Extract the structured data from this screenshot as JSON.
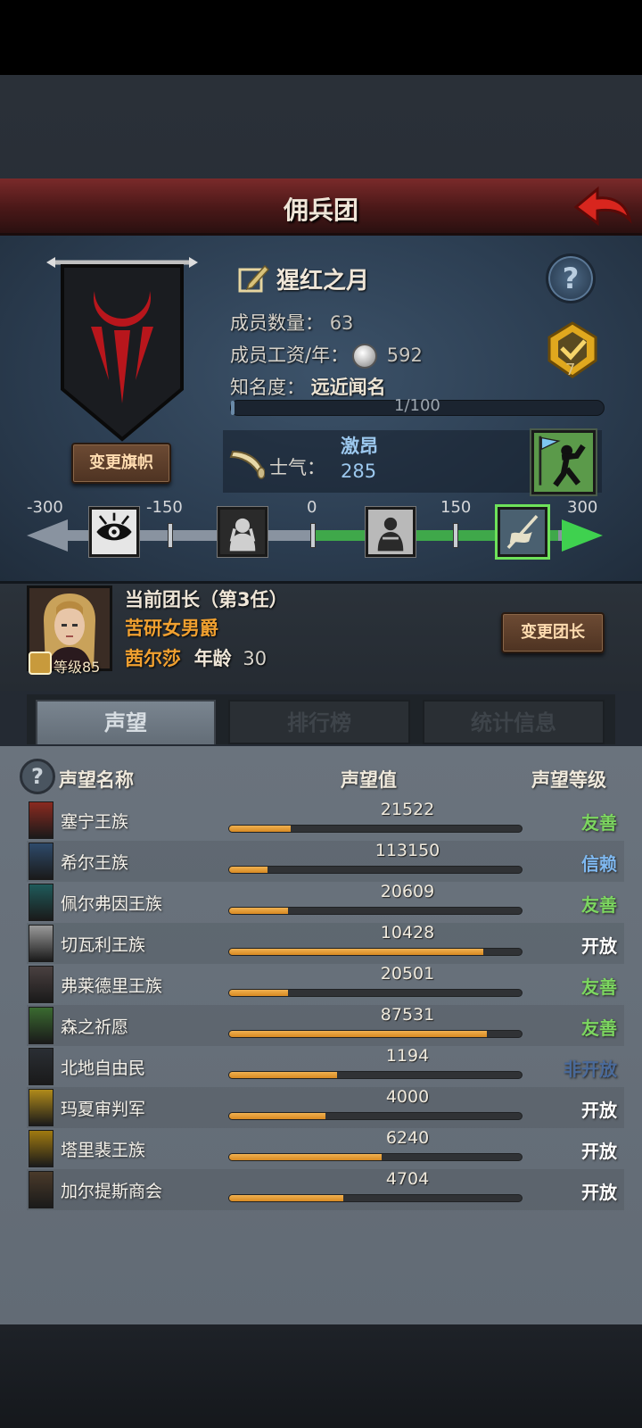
{
  "title": "佣兵团",
  "guild": {
    "name": "猩红之月",
    "member_count_label": "成员数量：",
    "member_count": "63",
    "salary_label": "成员工资/年：",
    "salary": "592",
    "fame_label": "知名度：",
    "fame": "远近闻名",
    "fame_progress": "1/100",
    "fame_fraction": 0.01,
    "change_banner_label": "变更旗帜",
    "rank_number": "7"
  },
  "morale": {
    "label": "士气：",
    "word": "激昂",
    "value": "285",
    "value_num": 285,
    "scale_labels": [
      "-300",
      "-150",
      "0",
      "150",
      "300"
    ],
    "scale_icons": [
      "eye-icon",
      "despair-icon",
      "calm-icon",
      "rally-icon"
    ]
  },
  "leader": {
    "title": "当前团长（第3任）",
    "rank": "苦研女男爵",
    "name": "茜尔莎",
    "age_label": "年龄",
    "age": "30",
    "level": "等级85",
    "change_leader_label": "变更团长"
  },
  "tabs": [
    {
      "label": "声望",
      "active": true
    },
    {
      "label": "排行榜",
      "active": false
    },
    {
      "label": "统计信息",
      "active": false
    }
  ],
  "reputation": {
    "headers": {
      "name": "声望名称",
      "value": "声望值",
      "level": "声望等级"
    },
    "rows": [
      {
        "name": "塞宁王族",
        "value": "21522",
        "fraction": 0.21,
        "level": "友善",
        "level_color": "#7cd660",
        "icon": "saining-crest-icon",
        "icon_color": "#8a2a20"
      },
      {
        "name": "希尔王族",
        "value": "113150",
        "fraction": 0.13,
        "level": "信赖",
        "level_color": "#7fb8f0",
        "icon": "xier-crest-icon",
        "icon_color": "#2e4a6a"
      },
      {
        "name": "佩尔弗因王族",
        "value": "20609",
        "fraction": 0.2,
        "level": "友善",
        "level_color": "#7cd660",
        "icon": "peierfuyin-crest-icon",
        "icon_color": "#1f5a5a"
      },
      {
        "name": "切瓦利王族",
        "value": "10428",
        "fraction": 0.87,
        "level": "开放",
        "level_color": "#ffffff",
        "icon": "qiewali-crest-icon",
        "icon_color": "#9a9a9a"
      },
      {
        "name": "弗莱德里王族",
        "value": "20501",
        "fraction": 0.2,
        "level": "友善",
        "level_color": "#7cd660",
        "icon": "fulaideli-crest-icon",
        "icon_color": "#4a4040"
      },
      {
        "name": "森之祈愿",
        "value": "87531",
        "fraction": 0.88,
        "level": "友善",
        "level_color": "#7cd660",
        "icon": "forest-prayer-icon",
        "icon_color": "#3a6a30"
      },
      {
        "name": "北地自由民",
        "value": "1194",
        "fraction": 0.37,
        "level": "非开放",
        "level_color": "#4a6a9a",
        "icon": "northland-icon",
        "icon_color": "#2a2e34"
      },
      {
        "name": "玛夏审判军",
        "value": "4000",
        "fraction": 0.33,
        "level": "开放",
        "level_color": "#ffffff",
        "icon": "maxia-judgment-icon",
        "icon_color": "#b08a1a"
      },
      {
        "name": "塔里裴王族",
        "value": "6240",
        "fraction": 0.52,
        "level": "开放",
        "level_color": "#ffffff",
        "icon": "talipei-crest-icon",
        "icon_color": "#a07a10"
      },
      {
        "name": "加尔提斯商会",
        "value": "4704",
        "fraction": 0.39,
        "level": "开放",
        "level_color": "#ffffff",
        "icon": "jiartisi-guild-icon",
        "icon_color": "#4a3a2a"
      }
    ]
  }
}
